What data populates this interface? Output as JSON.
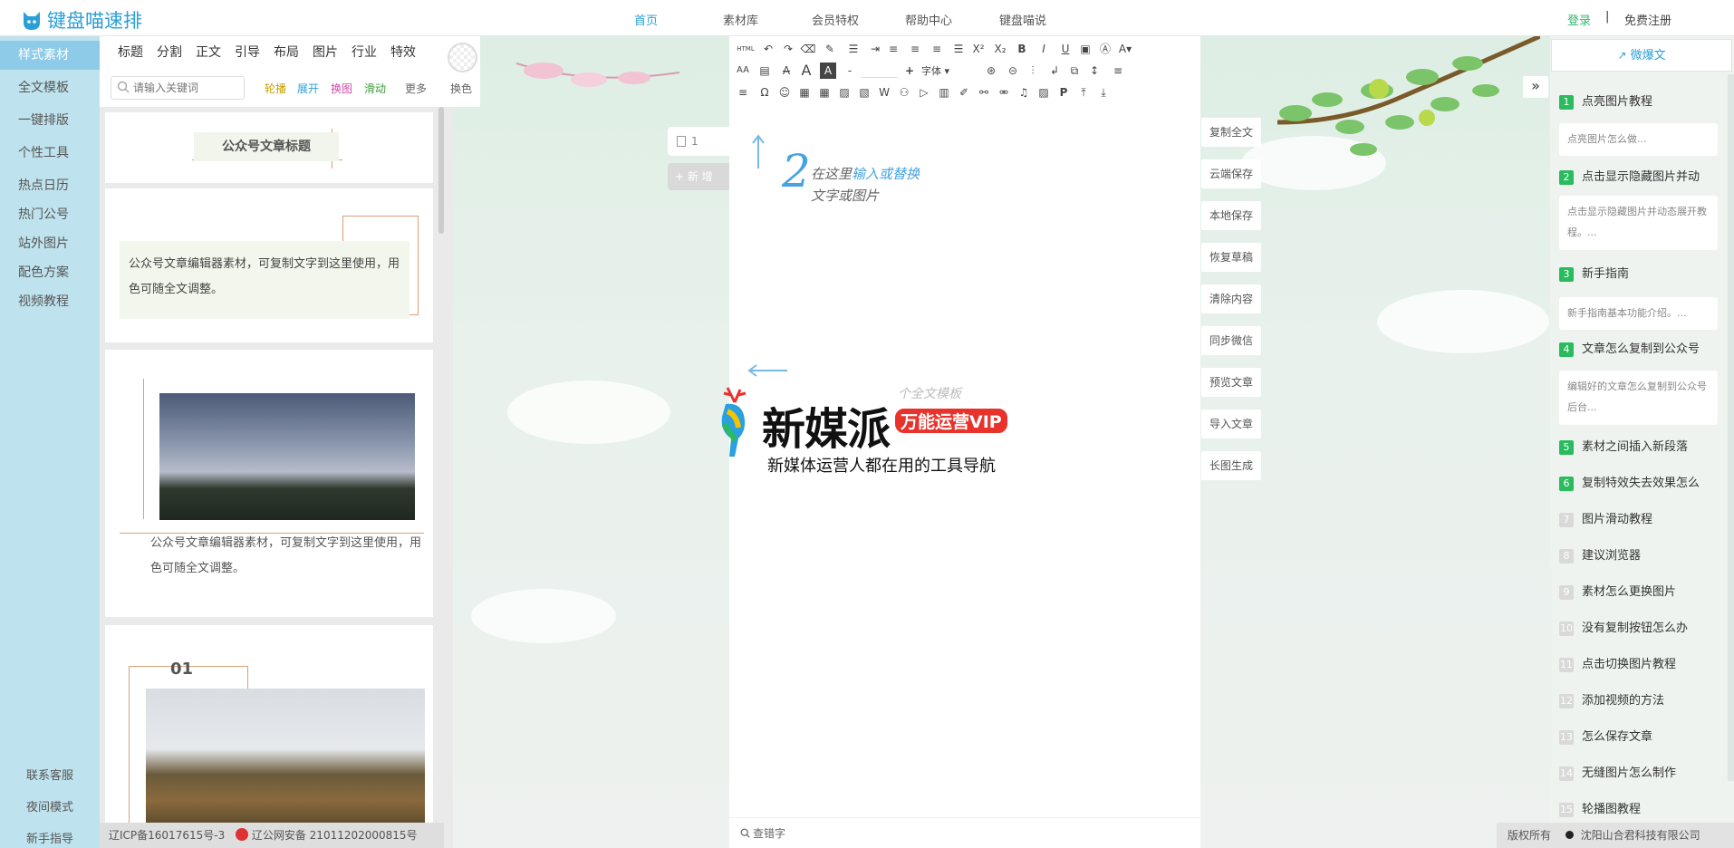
{
  "header": {
    "logo_text": "键盘喵速排",
    "nav": [
      "首页",
      "素材库",
      "会员特权",
      "帮助中心",
      "键盘喵说"
    ],
    "login": "登录",
    "separator": "|",
    "register": "免费注册"
  },
  "left_menu": {
    "items": [
      "样式素材",
      "全文模板",
      "一键排版",
      "个性工具",
      "热点日历",
      "热门公号",
      "站外图片",
      "配色方案",
      "视频教程"
    ],
    "bottom": [
      "联系客服",
      "夜间模式",
      "新手指导"
    ]
  },
  "material": {
    "tabs": [
      "标题",
      "分割",
      "正文",
      "引导",
      "布局",
      "图片",
      "行业",
      "特效"
    ],
    "search_placeholder": "请输入关键词",
    "filters": [
      {
        "label": "轮播",
        "color": "#c8a000"
      },
      {
        "label": "展开",
        "color": "#2a9fd8"
      },
      {
        "label": "换图",
        "color": "#d04aa8"
      },
      {
        "label": "滑动",
        "color": "#3a9a3a"
      },
      {
        "label": "更多",
        "color": "#666666"
      }
    ],
    "swap_color": "换色",
    "card1_title": "公众号文章标题",
    "card2_text": "公众号文章编辑器素材，可复制文字到这里使用，用色可随全文调整。",
    "card3_text": "公众号文章编辑器素材，可复制文字到这里使用，用色可随全文调整。",
    "card4_number": "01"
  },
  "footer_left": {
    "icp": "辽ICP备16017615号-3",
    "police": "辽公网安备 21011202000815号"
  },
  "editor": {
    "page_number": "1",
    "new_label": "+ 新 增",
    "toolbar_html": "HTML",
    "font_label": "字体",
    "font_size_minus": "-",
    "font_size_plus": "+",
    "hint_number": "2",
    "hint_prefix": "在这里",
    "hint_highlight": "输入或替换",
    "hint_line2": "文字或图片",
    "watermark_ghost": "个全文模板",
    "watermark_title": "新媒派",
    "watermark_badge": "万能运营VIP",
    "watermark_sub": "新媒体运营人都在用的工具导航",
    "spellcheck": "查错字"
  },
  "actions": [
    "复制全文",
    "云端保存",
    "本地保存",
    "恢复草稿",
    "清除内容",
    "同步微信",
    "预览文章",
    "导入文章",
    "长图生成"
  ],
  "right_panel": {
    "collapse": "»",
    "tab": "微爆文",
    "items": [
      {
        "num": "1",
        "title": "点亮图片教程",
        "desc": "点亮图片怎么做..."
      },
      {
        "num": "2",
        "title": "点击显示隐藏图片并动",
        "desc": "点击显示隐藏图片并动态展开教程。..."
      },
      {
        "num": "3",
        "title": "新手指南",
        "desc": "新手指南基本功能介绍。..."
      },
      {
        "num": "4",
        "title": "文章怎么复制到公众号",
        "desc": "编辑好的文章怎么复制到公众号后台..."
      },
      {
        "num": "5",
        "title": "素材之间插入新段落"
      },
      {
        "num": "6",
        "title": "复制特效失去效果怎么"
      },
      {
        "num": "7",
        "title": "图片滑动教程"
      },
      {
        "num": "8",
        "title": "建议浏览器"
      },
      {
        "num": "9",
        "title": "素材怎么更换图片"
      },
      {
        "num": "10",
        "title": "没有复制按钮怎么办"
      },
      {
        "num": "11",
        "title": "点击切换图片教程"
      },
      {
        "num": "12",
        "title": "添加视频的方法"
      },
      {
        "num": "13",
        "title": "怎么保存文章"
      },
      {
        "num": "14",
        "title": "无缝图片怎么制作"
      },
      {
        "num": "15",
        "title": "轮播图教程"
      }
    ]
  },
  "footer_right": {
    "copyright": "版权所有",
    "company": "沈阳山合君科技有限公司"
  },
  "colors": {
    "accent": "#2a9fd8",
    "green": "#2bbb5f",
    "menu_bg": "#bfe3ee",
    "menu_active": "#8ecbe8"
  }
}
